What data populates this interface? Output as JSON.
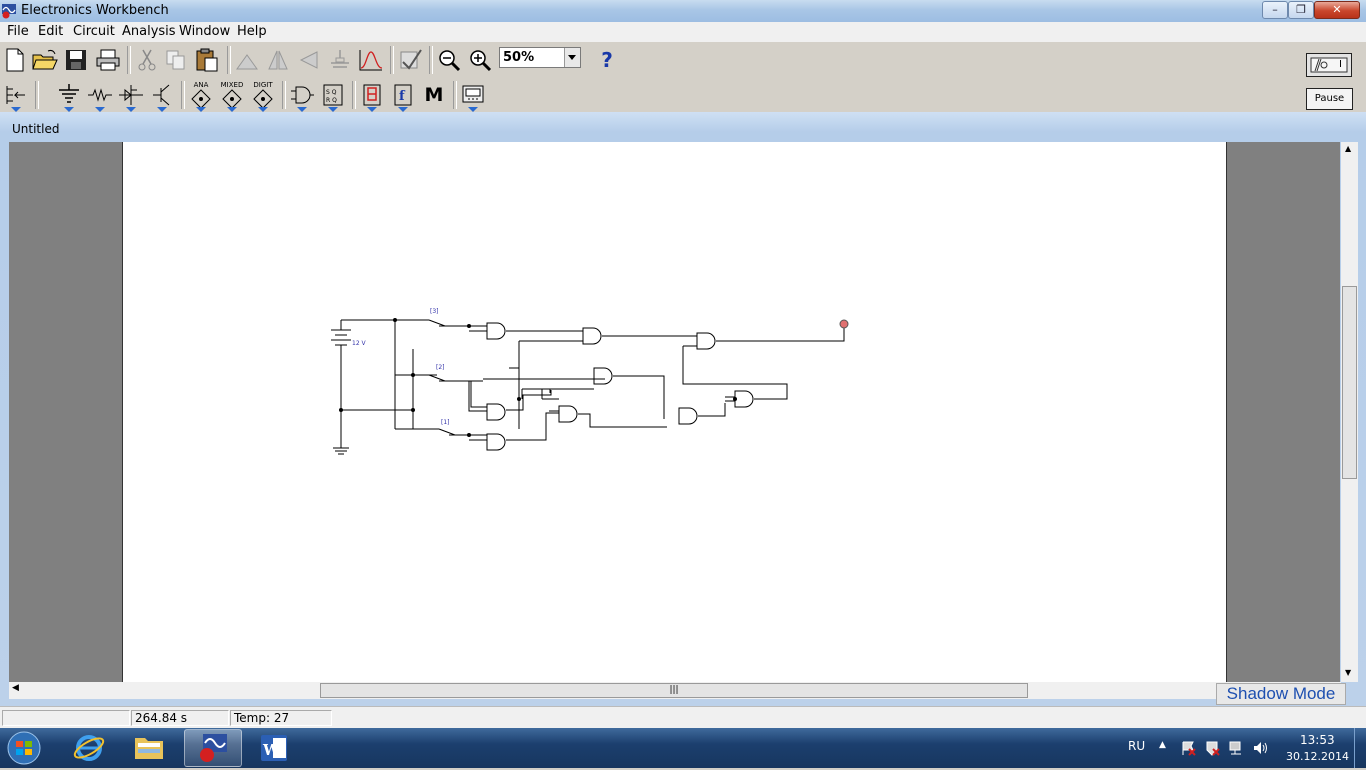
{
  "window": {
    "title": "Electronics Workbench",
    "controls": {
      "minimize": "–",
      "maximize": "❐",
      "close": "✕"
    }
  },
  "menubar": {
    "items": [
      "File",
      "Edit",
      "Circuit",
      "Analysis",
      "Window",
      "Help"
    ]
  },
  "toolbar": {
    "zoom_value": "50%",
    "help_label": "?",
    "parts_labels": {
      "analog": "ANA",
      "mixed": "MIXED",
      "digital": "DIGIT",
      "misc": "M"
    },
    "pause_label": "Pause",
    "power_label": "I"
  },
  "document": {
    "title": "Untitled"
  },
  "circuit": {
    "battery_label": "12 V",
    "switch_labels": [
      "[3]",
      "[2]",
      "[1]"
    ],
    "probe_color": "#e07070"
  },
  "statusbar": {
    "time": "264.84 s",
    "temp": "Temp:  27"
  },
  "shadow_mode_label": "Shadow Mode",
  "taskbar": {
    "language": "RU",
    "clock_time": "13:53",
    "clock_date": "30.12.2014"
  },
  "colors": {
    "title_bar": "#a9c6e6",
    "canvas": "#ffffff",
    "workspace_pad": "#808080",
    "taskbar": "#1c3f6e",
    "accent_blue": "#2a6ad0"
  }
}
